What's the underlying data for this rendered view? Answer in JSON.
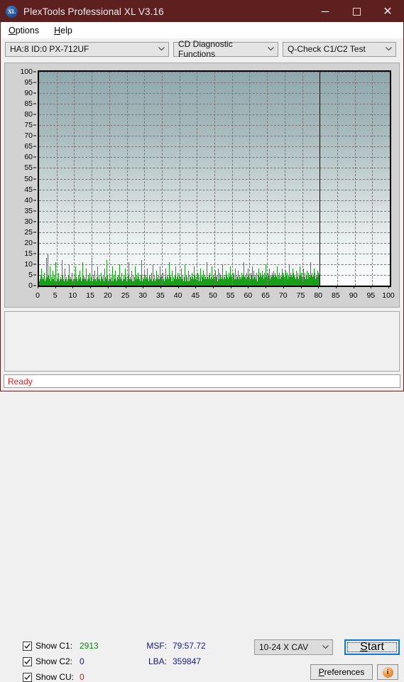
{
  "window": {
    "title": "PlexTools Professional XL V3.16",
    "logo_text": "XL",
    "controls": {
      "minimize": "minimize-icon",
      "maximize": "maximize-icon",
      "close": "close-icon"
    }
  },
  "menubar": {
    "items": [
      {
        "label": "Options",
        "accel": "O"
      },
      {
        "label": "Help",
        "accel": "H"
      }
    ]
  },
  "toolbar": {
    "drive": "HA:8 ID:0  PX-712UF",
    "function": "CD Diagnostic Functions",
    "test": "Q-Check C1/C2 Test",
    "caret_icon": "chevron-down-icon"
  },
  "controls": {
    "checkboxes": [
      {
        "label": "Show C1:",
        "value": "2913",
        "color": "#0a8a0a",
        "checked": true
      },
      {
        "label": "Show C2:",
        "value": "0",
        "color": "#0a0ad0",
        "checked": true
      },
      {
        "label": "Show CU:",
        "value": "0",
        "color": "#e01010",
        "checked": true
      }
    ],
    "readouts": [
      {
        "label": "MSF:",
        "value": "79:57.72"
      },
      {
        "label": "LBA:",
        "value": "359847"
      }
    ],
    "speed": "10-24 X CAV",
    "start_label": "Start",
    "start_accel": "S",
    "preferences_label": "Preferences",
    "preferences_accel": "P",
    "info_icon": "info-icon",
    "info_glyph": "i"
  },
  "statusbar": {
    "text": "Ready"
  },
  "chart_data": {
    "type": "bar",
    "title": "",
    "xlabel": "",
    "ylabel": "",
    "xlim": [
      0,
      100
    ],
    "ylim": [
      0,
      100
    ],
    "xticks": [
      0,
      5,
      10,
      15,
      20,
      25,
      30,
      35,
      40,
      45,
      50,
      55,
      60,
      65,
      70,
      75,
      80,
      85,
      90,
      95,
      100
    ],
    "yticks": [
      0,
      5,
      10,
      15,
      20,
      25,
      30,
      35,
      40,
      45,
      50,
      55,
      60,
      65,
      70,
      75,
      80,
      85,
      90,
      95,
      100
    ],
    "grid": true,
    "series_color": "#17a017",
    "data_end_x": 80,
    "end_marker_x": 80,
    "series": [
      {
        "name": "C1",
        "color": "#17a017",
        "values": [
          2,
          1,
          3,
          2,
          5,
          1,
          2,
          8,
          3,
          1,
          2,
          4,
          1,
          3,
          2,
          6,
          1,
          2,
          3,
          1,
          13,
          2,
          4,
          1,
          15,
          3,
          2,
          5,
          1,
          3,
          2,
          9,
          1,
          2,
          4,
          1,
          3,
          2,
          7,
          1,
          2,
          3,
          1,
          5,
          2,
          1,
          3,
          11,
          2,
          1,
          4,
          2,
          1,
          3,
          2,
          6,
          1,
          2,
          3,
          1,
          2,
          4,
          1,
          3,
          12,
          2,
          1,
          5,
          2,
          3,
          1,
          2,
          8,
          1,
          3,
          2,
          1,
          4,
          2,
          1,
          3,
          2,
          5,
          1,
          2,
          10,
          3,
          1,
          2,
          4,
          1,
          3,
          2,
          1,
          6,
          2,
          1,
          3,
          2,
          5,
          1,
          2,
          3,
          1,
          9,
          2,
          4,
          1,
          3,
          2,
          1,
          5,
          2,
          1,
          3,
          7,
          2,
          1,
          4,
          2,
          1,
          3,
          2,
          11,
          1,
          2,
          5,
          3,
          1,
          2,
          4,
          1,
          3,
          2,
          8,
          1,
          2,
          3,
          1,
          5,
          2,
          1,
          3,
          2,
          6,
          1,
          2,
          4,
          1,
          3,
          13,
          2,
          1,
          5,
          2,
          3,
          1,
          2,
          7,
          1,
          3,
          2,
          1,
          4,
          2,
          9,
          1,
          3,
          2,
          1,
          5,
          2,
          3,
          1,
          2,
          6,
          1,
          4,
          2,
          1,
          3,
          2,
          5,
          1,
          2,
          8,
          3,
          1,
          2,
          4,
          1,
          3,
          12,
          2,
          1,
          5,
          2,
          1,
          3,
          2,
          6,
          1,
          2,
          3,
          1,
          4,
          2,
          1,
          9,
          3,
          2,
          1,
          5,
          2,
          3,
          1,
          2,
          7,
          1,
          3,
          2,
          1,
          4,
          2,
          1,
          5,
          3,
          2,
          10,
          1,
          2,
          4,
          1,
          3,
          2,
          6,
          1,
          2,
          3,
          1,
          5,
          2,
          1,
          3,
          2,
          8,
          1,
          4,
          2,
          1,
          3,
          2,
          5,
          1,
          2,
          11,
          3,
          1,
          2,
          4,
          1,
          3,
          2,
          7,
          1,
          2,
          5,
          3,
          1,
          2,
          4,
          1,
          9,
          2,
          3,
          1,
          2,
          5,
          1,
          3,
          2,
          6,
          1,
          2,
          4,
          1,
          3,
          2,
          1,
          5,
          2,
          3,
          12,
          1,
          2,
          4,
          1,
          3,
          2,
          7,
          1,
          2,
          5,
          1,
          3,
          2,
          4,
          1,
          8,
          2,
          3,
          1,
          2,
          5,
          1,
          4,
          2,
          1,
          3,
          2,
          6,
          1,
          2,
          4,
          10,
          1,
          3,
          2,
          5,
          1,
          2,
          3,
          1,
          7,
          2,
          4,
          1,
          3,
          2,
          5,
          1,
          2,
          3,
          9,
          1,
          4,
          2,
          1,
          5,
          3,
          2,
          1,
          6,
          2,
          3,
          1,
          2,
          4,
          1,
          8,
          2,
          3,
          1,
          5,
          2,
          1,
          4,
          3,
          2,
          11,
          1,
          2,
          5,
          3,
          1,
          4,
          2,
          1,
          3,
          7,
          2,
          1,
          4,
          2,
          3,
          1,
          5,
          2,
          9,
          1,
          3,
          2,
          4,
          1,
          2,
          6,
          3,
          1,
          2,
          5,
          1,
          3,
          2,
          4,
          1,
          8,
          2,
          3,
          1,
          5,
          2,
          1,
          4,
          2,
          3,
          10,
          1,
          2,
          5,
          3,
          1,
          4,
          2,
          1,
          7,
          3,
          2,
          1,
          5,
          2,
          4,
          1,
          3,
          2,
          6,
          1,
          2,
          4,
          1,
          3,
          2,
          9,
          1,
          5,
          3,
          2,
          1,
          4,
          2,
          1,
          6,
          3,
          2,
          5,
          1,
          2,
          4,
          1,
          3,
          8,
          2,
          1,
          5,
          3,
          2,
          4,
          1,
          2,
          7,
          3,
          1,
          5,
          2,
          4,
          1,
          3,
          2,
          11,
          1,
          4,
          2,
          3,
          1,
          5,
          2,
          1,
          6,
          3,
          2,
          1,
          4,
          9,
          2,
          3,
          1,
          5,
          2,
          4,
          1,
          3,
          2,
          7,
          1,
          4,
          3,
          2,
          5,
          1,
          2,
          8,
          4,
          1,
          3,
          2,
          6,
          1,
          5,
          2,
          3,
          1,
          4,
          2,
          10,
          1,
          3,
          5,
          2,
          1,
          4,
          3,
          2,
          7,
          1,
          5,
          2,
          4,
          1,
          3,
          2,
          6,
          1,
          4,
          2,
          3,
          9,
          1,
          5,
          2,
          4,
          1,
          3,
          6,
          2,
          1,
          5,
          3,
          2,
          4,
          1,
          8,
          2,
          3,
          1,
          5,
          4,
          2,
          1,
          7,
          3,
          2,
          5,
          1,
          4,
          2,
          3,
          1,
          6,
          2,
          4,
          1,
          5,
          3,
          2,
          11,
          1,
          4,
          2,
          5,
          3,
          1,
          6,
          2,
          4,
          1,
          3,
          8,
          2,
          5,
          1,
          4,
          3,
          2,
          6,
          1,
          5,
          2,
          4,
          9,
          1,
          3,
          2,
          7,
          4,
          1,
          5,
          2,
          3,
          1,
          6,
          4,
          2,
          1,
          5,
          3,
          8,
          2,
          4,
          1,
          6,
          2,
          5,
          3,
          1,
          4,
          2,
          7,
          1,
          5,
          3,
          2,
          6,
          1,
          4,
          2,
          10,
          3,
          5,
          1,
          4,
          2,
          6,
          3,
          1,
          5,
          2,
          4,
          8,
          1,
          3,
          5,
          2,
          4,
          1,
          6,
          3,
          2,
          5,
          7,
          1,
          4,
          2,
          3,
          6,
          1,
          5,
          2,
          4,
          1,
          9,
          3,
          2,
          5,
          1,
          4,
          6,
          2,
          3,
          1,
          5,
          4,
          2,
          8,
          1,
          6,
          3,
          2,
          5,
          1,
          4,
          2,
          3,
          7,
          1,
          5,
          2,
          6,
          4,
          1,
          3,
          2,
          5,
          10,
          1,
          4,
          2,
          6,
          3,
          5,
          1,
          2,
          4,
          8,
          1,
          3,
          6,
          2,
          5,
          1,
          4,
          3,
          2,
          7,
          5,
          1,
          4,
          2,
          6,
          3,
          1,
          5,
          2,
          4,
          9,
          1,
          3,
          5,
          2,
          6,
          1,
          4,
          2,
          3,
          8,
          5,
          1,
          4,
          2,
          6,
          3,
          1,
          5,
          2,
          7,
          4,
          1,
          3,
          6,
          2,
          5,
          1,
          4,
          2,
          3,
          11,
          5,
          1,
          6,
          2,
          4,
          3,
          1,
          5,
          2,
          8,
          4,
          6,
          1,
          3,
          5,
          2,
          4,
          1,
          7,
          3,
          6,
          2,
          5,
          1,
          4,
          2
        ]
      }
    ]
  }
}
